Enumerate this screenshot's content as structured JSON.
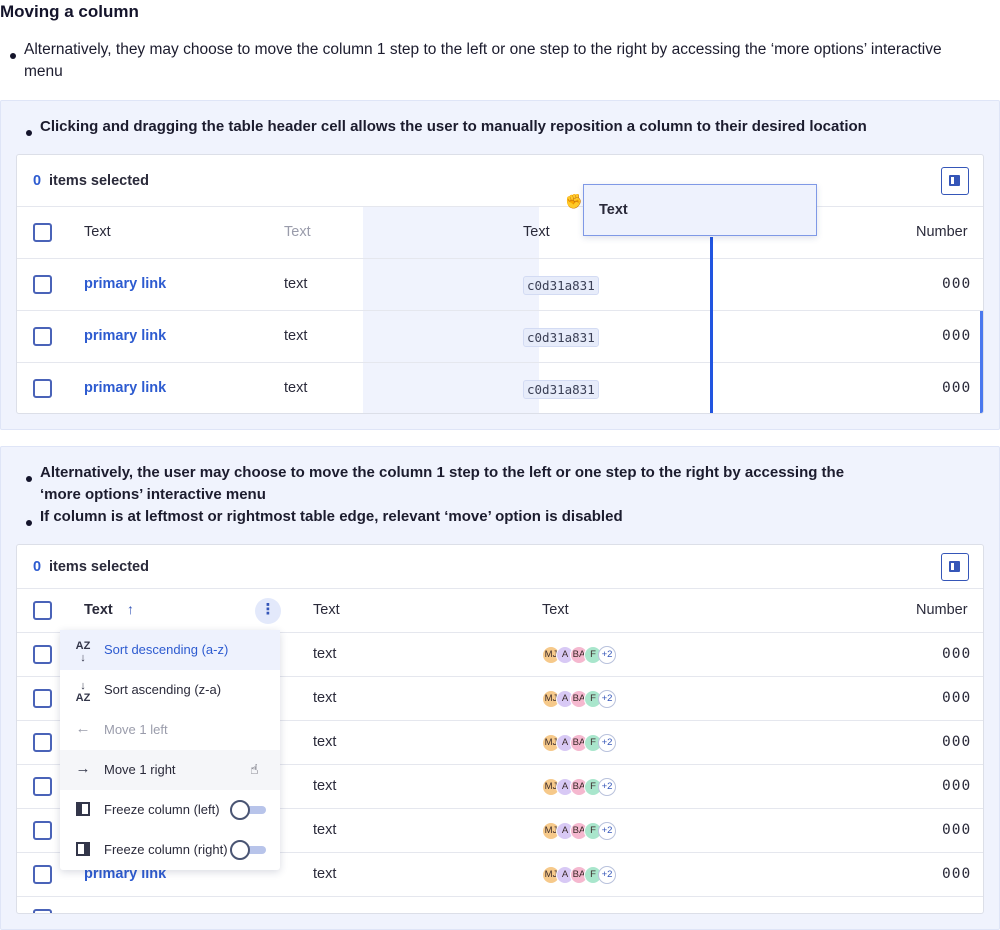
{
  "page_title": "Moving a column",
  "intro_bullet": "Alternatively, they may choose to move the column 1 step to the left or one step to the right by accessing the ‘more options’ interactive menu",
  "section1": {
    "bullet": "Clicking and dragging the table header cell allows the user to manually reposition a column to their desired location",
    "table": {
      "selected_count": "0",
      "selected_label": "items selected",
      "headers": [
        "Text",
        "Text",
        "Text",
        "Number"
      ],
      "dragged_header": "Text",
      "rows": [
        {
          "link": "primary link",
          "text": "text",
          "hash": "c0d31a831",
          "number": "000"
        },
        {
          "link": "primary link",
          "text": "text",
          "hash": "c0d31a831",
          "number": "000"
        },
        {
          "link": "primary link",
          "text": "text",
          "hash": "c0d31a831",
          "number": "000"
        }
      ]
    }
  },
  "section2": {
    "bullets": [
      "Alternatively, the user may choose to move the column 1 step to the left or one step to the right by accessing the ‘more options’ interactive menu",
      "If column is at leftmost or rightmost table edge, relevant ‘move’ option is disabled"
    ],
    "table": {
      "selected_count": "0",
      "selected_label": "items selected",
      "headers": [
        "Text",
        "Text",
        "Text",
        "Number"
      ],
      "rows": [
        {
          "link": "primary link",
          "text": "text",
          "number": "000"
        },
        {
          "link": "primary link",
          "text": "text",
          "number": "000"
        },
        {
          "link": "primary link",
          "text": "text",
          "number": "000"
        },
        {
          "link": "primary link",
          "text": "text",
          "number": "000"
        },
        {
          "link": "primary link",
          "text": "text",
          "number": "000"
        },
        {
          "link": "primary link",
          "text": "text",
          "number": "000"
        }
      ],
      "avatars": [
        {
          "label": "MJ",
          "color": "#f6c98a"
        },
        {
          "label": "A",
          "color": "#d8c9f5"
        },
        {
          "label": "BA",
          "color": "#f5b8cf"
        },
        {
          "label": "F",
          "color": "#a9e6cc"
        },
        {
          "label": "+2",
          "color": "#ffffff"
        }
      ],
      "menu": {
        "items": [
          {
            "label": "Sort descending (a-z)",
            "icon": "sort-descending-icon",
            "state": "active"
          },
          {
            "label": "Sort ascending (z-a)",
            "icon": "sort-ascending-icon",
            "state": "normal"
          },
          {
            "label": "Move 1 left",
            "icon": "arrow-left-icon",
            "state": "disabled"
          },
          {
            "label": "Move 1 right",
            "icon": "arrow-right-icon",
            "state": "hover"
          },
          {
            "label": "Freeze column (left)",
            "icon": "freeze-left-icon",
            "state": "normal",
            "toggle": "off"
          },
          {
            "label": "Freeze column (right)",
            "icon": "freeze-right-icon",
            "state": "normal",
            "toggle": "off"
          }
        ]
      }
    }
  },
  "colors": {
    "accent": "#2d5bd0",
    "drag_indicator": "#2155e0",
    "panel_bg": "#f0f3fd",
    "disabled": "#9a9cab"
  }
}
